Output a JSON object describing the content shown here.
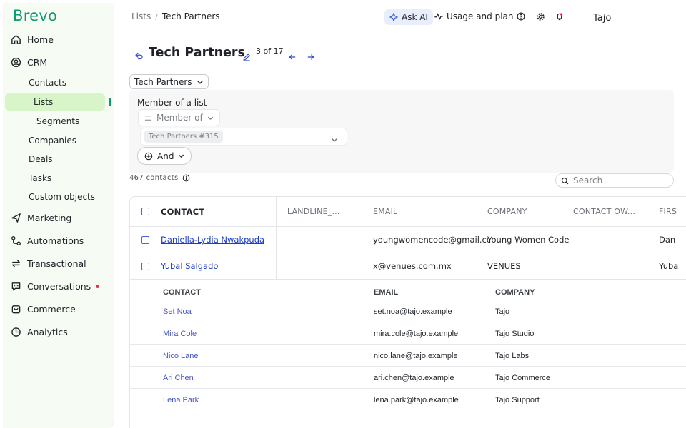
{
  "brand": "Brevo",
  "sidebar": {
    "items": [
      {
        "label": "Home",
        "icon": "home-icon"
      },
      {
        "label": "CRM",
        "icon": "crm-icon"
      },
      {
        "label": "Marketing",
        "icon": "send-icon"
      },
      {
        "label": "Automations",
        "icon": "automation-icon"
      },
      {
        "label": "Transactional",
        "icon": "repeat-icon"
      },
      {
        "label": "Conversations",
        "icon": "chat-icon"
      },
      {
        "label": "Commerce",
        "icon": "bag-icon"
      },
      {
        "label": "Analytics",
        "icon": "pie-icon"
      }
    ],
    "crm_sub": {
      "contacts": "Contacts",
      "lists": "Lists",
      "segments": "Segments",
      "companies": "Companies",
      "deals": "Deals",
      "tasks": "Tasks",
      "custom_objects": "Custom objects"
    }
  },
  "topbar": {
    "breadcrumb_root": "Lists",
    "breadcrumb_sep": "/",
    "breadcrumb_current": "Tech Partners",
    "ask_ai": "Ask AI",
    "usage": "Usage and plan",
    "user": "Tajo"
  },
  "page": {
    "title": "Tech Partners",
    "pager": "3 of 17",
    "list_select": "Tech Partners"
  },
  "filter": {
    "label": "Member of a list",
    "member_of": "Member of",
    "tag": "Tech Partners #315",
    "and": "And"
  },
  "contacts_count": "467 contacts",
  "search": {
    "placeholder": "Search"
  },
  "table": {
    "headers": [
      "CONTACT",
      "LANDLINE_...",
      "EMAIL",
      "COMPANY",
      "CONTACT OW...",
      "FIRS"
    ],
    "rows": [
      {
        "contact": "Daniella-Lydia Nwakpuda",
        "email": "youngwomencode@gmail.com",
        "company": "Young Women Code",
        "first": "Dan"
      },
      {
        "contact": "Yubal Salgado",
        "email": "x@venues.com.mx",
        "company": "VENUES",
        "first": "Yuba"
      }
    ]
  },
  "subtable": {
    "headers": [
      "CONTACT",
      "EMAIL",
      "COMPANY"
    ],
    "rows": [
      {
        "contact": "Set Noa",
        "email": "set.noa@tajo.example",
        "company": "Tajo"
      },
      {
        "contact": "Mira Cole",
        "email": "mira.cole@tajo.example",
        "company": "Tajo Studio"
      },
      {
        "contact": "Nico Lane",
        "email": "nico.lane@tajo.example",
        "company": "Tajo Labs"
      },
      {
        "contact": "Ari Chen",
        "email": "ari.chen@tajo.example",
        "company": "Tajo Commerce"
      },
      {
        "contact": "Lena Park",
        "email": "lena.park@tajo.example",
        "company": "Tajo Support"
      }
    ]
  },
  "colors": {
    "brand": "#0b996e",
    "active_bg": "#d7f5c9",
    "link": "#1b3bc9",
    "notification": "#e0314b"
  }
}
